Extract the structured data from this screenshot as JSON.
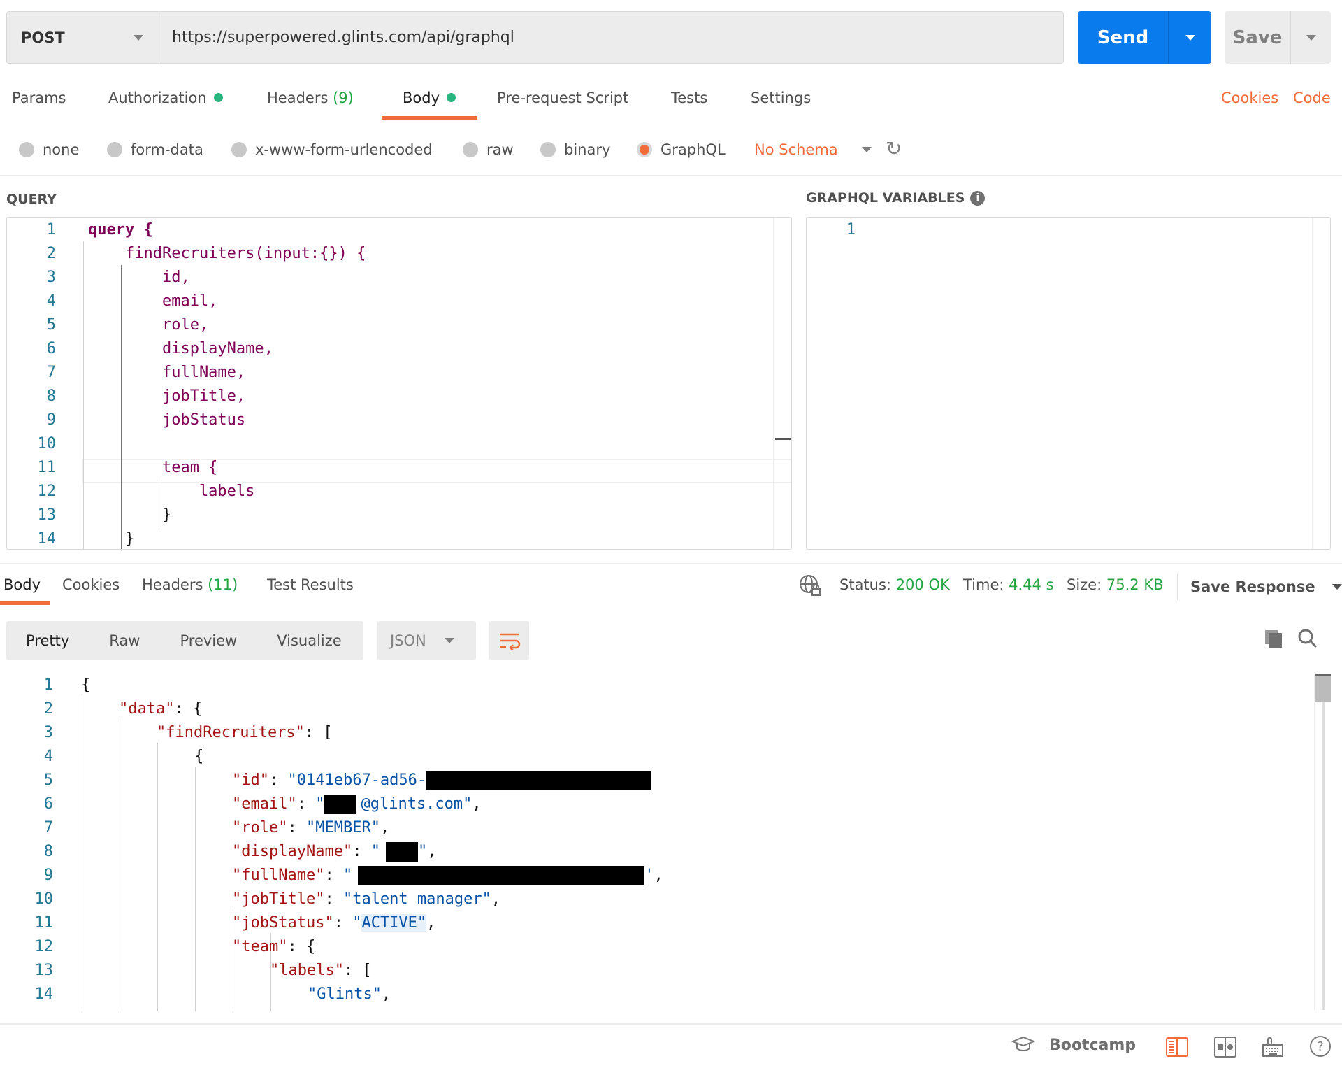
{
  "request": {
    "method": "POST",
    "url": "https://superpowered.glints.com/api/graphql",
    "send_label": "Send",
    "save_label": "Save"
  },
  "tabs": [
    {
      "label": "Params"
    },
    {
      "label": "Authorization",
      "dot": true
    },
    {
      "label": "Headers",
      "count": "(9)"
    },
    {
      "label": "Body",
      "dot": true,
      "active": true
    },
    {
      "label": "Pre-request Script"
    },
    {
      "label": "Tests"
    },
    {
      "label": "Settings"
    }
  ],
  "links": {
    "cookies": "Cookies",
    "code": "Code"
  },
  "body_types": [
    "none",
    "form-data",
    "x-www-form-urlencoded",
    "raw",
    "binary",
    "GraphQL"
  ],
  "selected_body_type": "GraphQL",
  "schema": "No Schema",
  "query_label": "QUERY",
  "variables_label": "GRAPHQL VARIABLES",
  "query_lines": [
    "query {",
    "    findRecruiters(input:{}) {",
    "        id,",
    "        email,",
    "        role,",
    "        displayName,",
    "        fullName,",
    "        jobTitle,",
    "        jobStatus",
    "",
    "        team {",
    "            labels",
    "        }",
    "    }"
  ],
  "variables_lines": [
    "1"
  ],
  "response": {
    "tabs": [
      {
        "label": "Body",
        "active": true
      },
      {
        "label": "Cookies"
      },
      {
        "label": "Headers",
        "count": "(11)"
      },
      {
        "label": "Test Results"
      }
    ],
    "status_label": "Status:",
    "status": "200 OK",
    "time_label": "Time:",
    "time": "4.44 s",
    "size_label": "Size:",
    "size": "75.2 KB",
    "save_response": "Save Response",
    "views": [
      "Pretty",
      "Raw",
      "Preview",
      "Visualize"
    ],
    "active_view": "Pretty",
    "format": "JSON",
    "lines": {
      "l1": "{",
      "l2k": "\"data\"",
      "l2": ": {",
      "l3k": "\"findRecruiters\"",
      "l3": ": [",
      "l4": "{",
      "id_k": "\"id\"",
      "id_v": "\"0141eb67-ad56-",
      "email_k": "\"email\"",
      "email_v": "@glints.com\"",
      "role_k": "\"role\"",
      "role_v": "\"MEMBER\"",
      "dn_k": "\"displayName\"",
      "fn_k": "\"fullName\"",
      "jt_k": "\"jobTitle\"",
      "jt_v": "\"talent manager\"",
      "js_k": "\"jobStatus\"",
      "js_v": "\"ACTIVE\"",
      "team_k": "\"team\"",
      "labels_k": "\"labels\"",
      "g_v": "\"Glints\""
    }
  },
  "footer": {
    "bootcamp": "Bootcamp"
  },
  "colors": {
    "accent": "#f26b3a",
    "send": "#097bed",
    "success": "#26a544"
  }
}
